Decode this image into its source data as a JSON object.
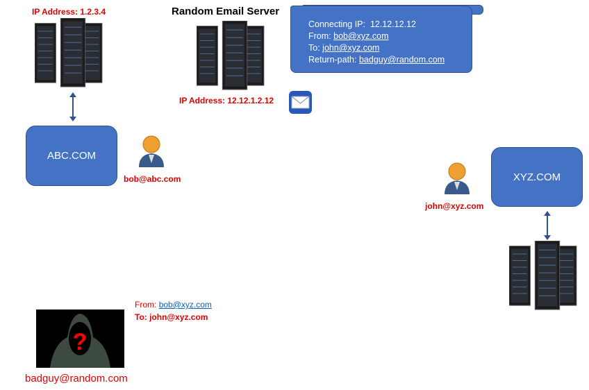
{
  "left_server": {
    "ip_label": "IP Address: 1.2.3.4"
  },
  "random_server": {
    "title": "Random Email Server",
    "ip_label": "IP Address: 12.12.1.2.12"
  },
  "header_callout": {
    "connecting_ip_label": "Connecting IP:",
    "connecting_ip": "12.12.12.12",
    "from_label": "From:",
    "from": "bob@xyz.com",
    "to_label": "To:",
    "to": "john@xyz.com",
    "return_path_label": "Return-path:",
    "return_path": "badguy@random.com"
  },
  "abc": {
    "domain": "ABC.COM",
    "user": "bob@abc.com"
  },
  "xyz": {
    "domain": "XYZ.COM",
    "user": "john@xyz.com"
  },
  "attacker": {
    "from_label": "From:",
    "from": "bob@xyz.com",
    "to_line": "To: john@xyz.com",
    "address": "badguy@random.com"
  },
  "colors": {
    "box": "#4472c4",
    "label_red": "#e00000",
    "link": "#0563c1"
  }
}
